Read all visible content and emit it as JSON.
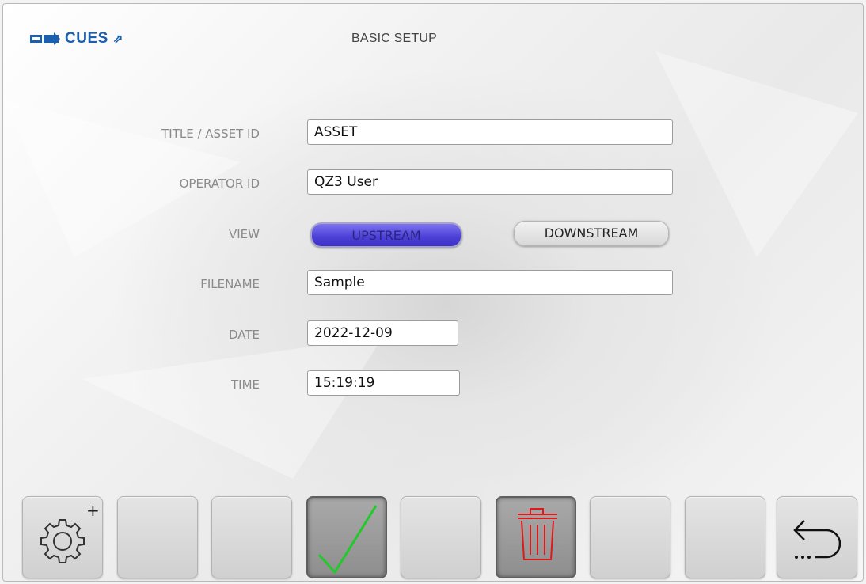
{
  "header": {
    "brand": "CUES",
    "brand_arrow": "⇗",
    "title": "BASIC SETUP"
  },
  "form": {
    "title_label": "TITLE / ASSET ID",
    "title_value": "ASSET",
    "operator_label": "OPERATOR ID",
    "operator_value": "QZ3 User",
    "view_label": "VIEW",
    "view_options": [
      "UPSTREAM",
      "DOWNSTREAM"
    ],
    "view_selected": "UPSTREAM",
    "filename_label": "FILENAME",
    "filename_value": "Sample",
    "date_label": "DATE",
    "date_value": "2022-12-09",
    "time_label": "TIME",
    "time_value": "15:19:19"
  },
  "toolbar": {
    "buttons": [
      {
        "name": "settings-plus",
        "icon": "gear-plus-icon"
      },
      {
        "name": "empty-1",
        "icon": ""
      },
      {
        "name": "empty-2",
        "icon": ""
      },
      {
        "name": "confirm",
        "icon": "checkmark-icon",
        "color": "#21c92a"
      },
      {
        "name": "empty-3",
        "icon": ""
      },
      {
        "name": "delete",
        "icon": "trash-icon",
        "color": "#e01818"
      },
      {
        "name": "empty-4",
        "icon": ""
      },
      {
        "name": "empty-5",
        "icon": ""
      },
      {
        "name": "back",
        "icon": "return-arrow-icon"
      }
    ]
  },
  "colors": {
    "brand": "#1c5fae",
    "toggle_on": "#4b3fd6"
  }
}
